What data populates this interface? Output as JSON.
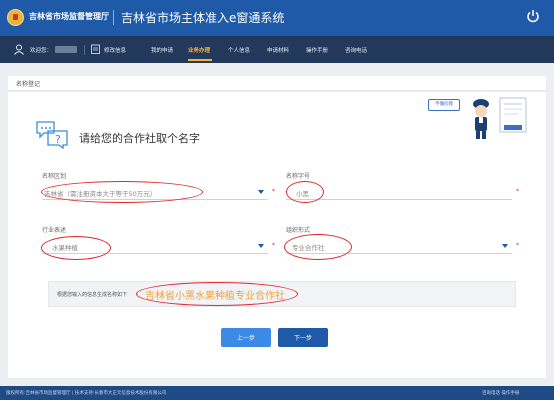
{
  "header": {
    "agency": "吉林省市场监督管理厅",
    "system_title": "吉林省市场主体准入e窗通系统"
  },
  "nav": {
    "greeting": "欢迎您：",
    "items": [
      {
        "label": "修改信息"
      },
      {
        "label": "我的申请"
      },
      {
        "label": "业务办理"
      },
      {
        "label": "个人信息"
      },
      {
        "label": "申请材料"
      },
      {
        "label": "操作手册"
      },
      {
        "label": "咨询电话"
      }
    ],
    "active": "业务办理"
  },
  "breadcrumb": "名称登记",
  "card": {
    "title": "请给您的合作社取个名字",
    "help_bubble": "不懂问我",
    "fields": {
      "region": {
        "label": "名称区划",
        "value": "吉林省（需注册资本大于等于50万元）"
      },
      "keyword": {
        "label": "名称字号",
        "value": "小黑"
      },
      "industry": {
        "label": "行业表述",
        "value": "水果种植"
      },
      "org_form": {
        "label": "组织形式",
        "value": "专业合作社"
      }
    },
    "preview_label": "根据您输入的信息生成名称如下",
    "preview_name": "吉林省小黑水果种植专业合作社",
    "prev_button": "上一步",
    "next_button": "下一步"
  },
  "footer": {
    "copyright": "版权所有:吉林省市场监督管理厅 | 技术支持:长春市大正元信息技术股份有限公司",
    "right": "咨询电话  操作手册"
  },
  "colors": {
    "header_bg": "#1e5aa8",
    "nav_bg": "#22395c",
    "active_nav": "#f3b33d",
    "annotation_red": "#e0282d",
    "preview_orange": "#f0a23a"
  },
  "icons": [
    "emblem-icon",
    "power-icon",
    "user-icon",
    "home-icon",
    "qa-icon",
    "mascot-icon",
    "chevron-down-icon"
  ]
}
